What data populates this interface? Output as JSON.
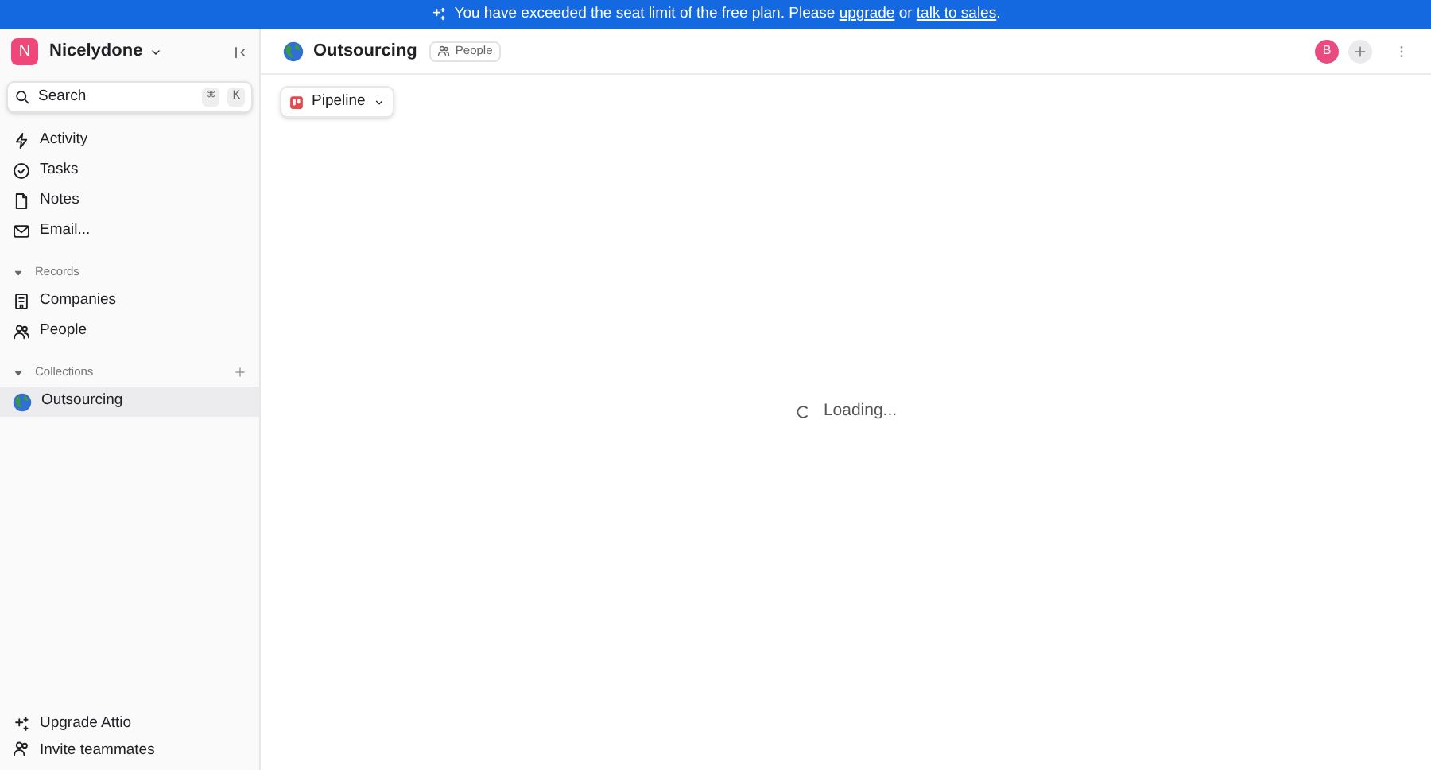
{
  "banner": {
    "text_before": "You have exceeded the seat limit of the free plan. Please ",
    "link_upgrade": "upgrade",
    "text_middle": " or ",
    "link_sales": "talk to sales",
    "text_after": "."
  },
  "sidebar": {
    "workspace": {
      "initial": "N",
      "name": "Nicelydone"
    },
    "search": {
      "placeholder": "Search",
      "keys": [
        "⌘",
        "K"
      ]
    },
    "nav": [
      {
        "kind": "activity",
        "label": "Activity"
      },
      {
        "kind": "tasks",
        "label": "Tasks"
      },
      {
        "kind": "notes",
        "label": "Notes"
      },
      {
        "kind": "email",
        "label": "Email..."
      }
    ],
    "sections": [
      {
        "title": "Records",
        "expanded": true,
        "addable": false,
        "items": [
          {
            "kind": "companies",
            "label": "Companies",
            "selected": false
          },
          {
            "kind": "people",
            "label": "People",
            "selected": false
          }
        ]
      },
      {
        "title": "Collections",
        "expanded": true,
        "addable": true,
        "items": [
          {
            "kind": "globe",
            "label": "Outsourcing",
            "selected": true
          }
        ]
      }
    ],
    "footer": [
      {
        "kind": "upgrade",
        "label": "Upgrade Attio"
      },
      {
        "kind": "invite",
        "label": "Invite teammates"
      }
    ]
  },
  "header": {
    "title": "Outsourcing",
    "tag": "People",
    "avatar": "B"
  },
  "view": {
    "label": "Pipeline"
  },
  "loading": {
    "text": "Loading..."
  }
}
